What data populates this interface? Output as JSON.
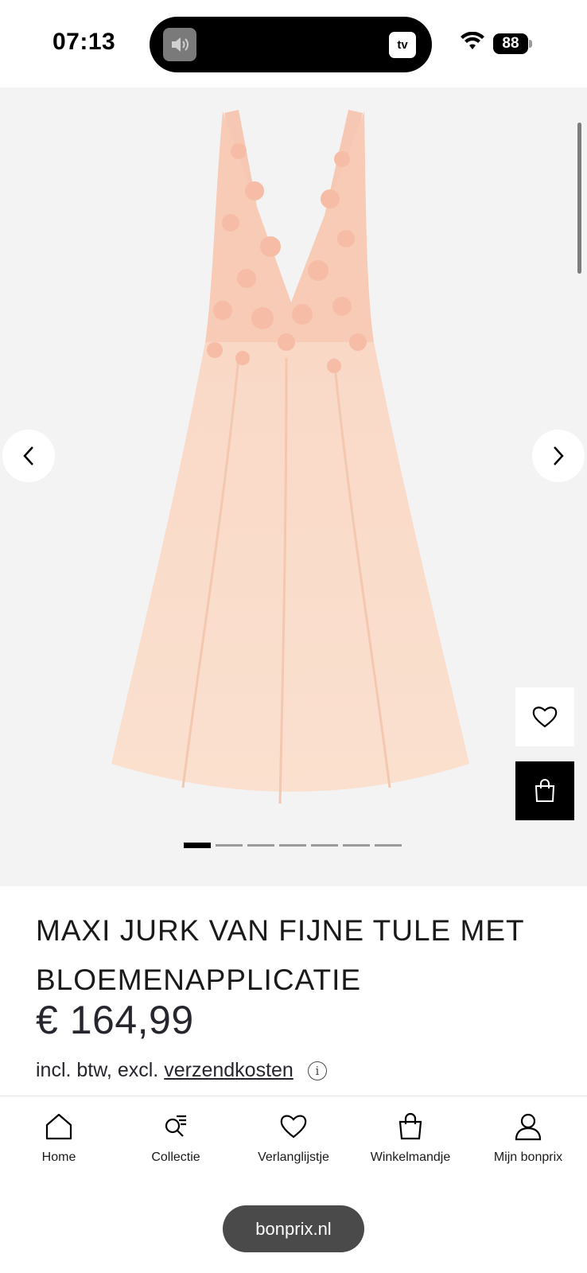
{
  "status_bar": {
    "time": "07:13",
    "battery": "88",
    "tv_label": "tv"
  },
  "product": {
    "title": "MAXI JURK VAN FIJNE TULE MET BLOEMENAPPLICATIE",
    "price": "€ 164,99",
    "tax_prefix": "incl. btw, excl.",
    "shipping_link": "verzendkosten",
    "info_icon": "i"
  },
  "gallery": {
    "image_count": 7,
    "active_index": 0
  },
  "nav": [
    {
      "label": "Home",
      "icon": "home-icon"
    },
    {
      "label": "Collectie",
      "icon": "collection-search-icon"
    },
    {
      "label": "Verlanglijstje",
      "icon": "heart-icon"
    },
    {
      "label": "Winkelmandje",
      "icon": "shopping-bag-icon"
    },
    {
      "label": "Mijn bonprix",
      "icon": "user-icon"
    }
  ],
  "browser": {
    "url": "bonprix.nl"
  },
  "colors": {
    "accent": "#000000",
    "dress": "#f8d3bd",
    "background": "#f3f3f3"
  }
}
